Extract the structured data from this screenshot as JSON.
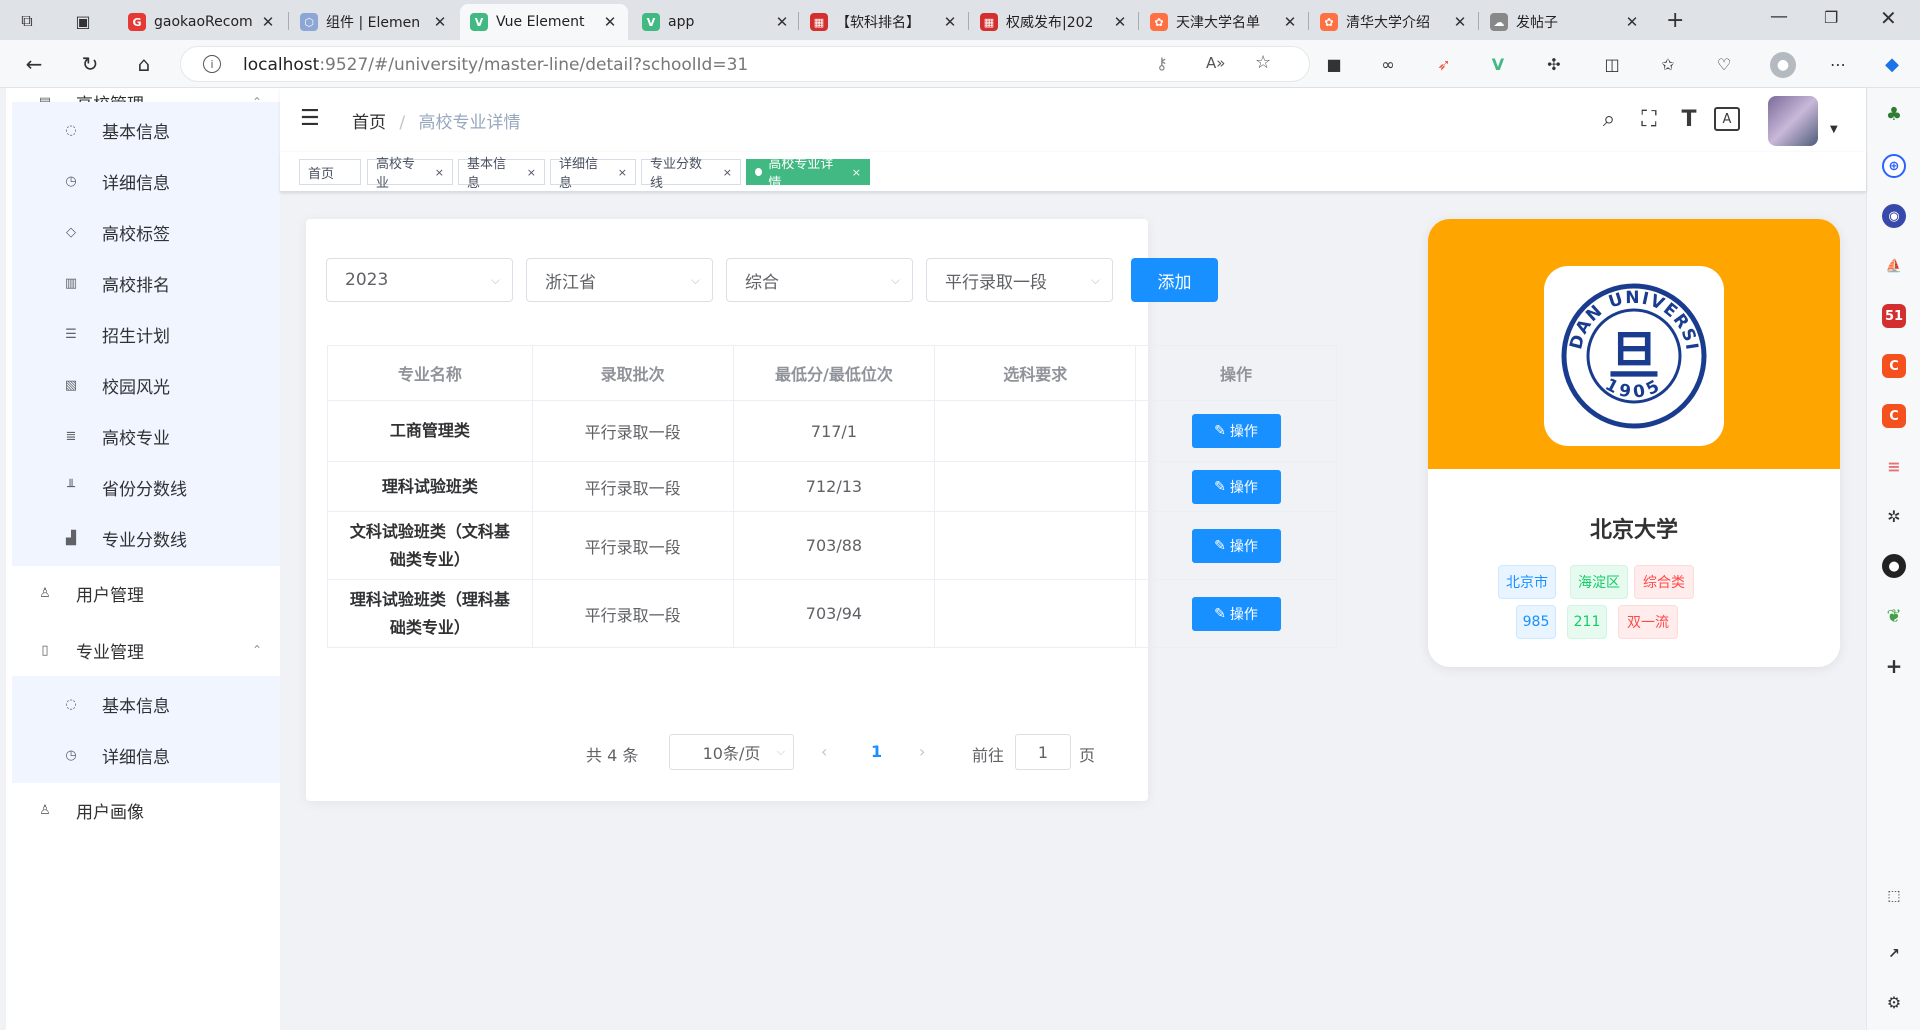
{
  "browser": {
    "tabs": [
      {
        "title": "gaokaoRecom",
        "fav_color": "#e53935",
        "fav_char": "G"
      },
      {
        "title": "组件 | Elemen",
        "fav_color": "#8ca6d6",
        "fav_char": "⬡"
      },
      {
        "title": "Vue Element",
        "fav_color": "#42b983",
        "fav_char": "V",
        "active": true
      },
      {
        "title": "app",
        "fav_color": "#42b983",
        "fav_char": "V"
      },
      {
        "title": "【软科排名】",
        "fav_color": "#d32f2f",
        "fav_char": "▦"
      },
      {
        "title": "权威发布|202",
        "fav_color": "#d32f2f",
        "fav_char": "▦"
      },
      {
        "title": "天津大学名单",
        "fav_color": "#ff7043",
        "fav_char": "✿"
      },
      {
        "title": "清华大学介绍",
        "fav_color": "#ff7043",
        "fav_char": "✿"
      },
      {
        "title": "发帖子",
        "fav_color": "#888888",
        "fav_char": "☁"
      }
    ],
    "new_tab": "+",
    "url_host": "localhost",
    "url_rest": ":9527/#/university/master-line/detail?schoolId=31"
  },
  "sidebar": {
    "items": [
      {
        "label": "高校管理",
        "type": "top",
        "icon": "university-icon",
        "glyph": "▤",
        "caret": "⌃"
      },
      {
        "label": "基本信息",
        "type": "sub",
        "icon": "chat-icon",
        "glyph": "◌"
      },
      {
        "label": "详细信息",
        "type": "sub",
        "icon": "clock-icon",
        "glyph": "◷"
      },
      {
        "label": "高校标签",
        "type": "sub",
        "icon": "tag-icon",
        "glyph": "◇"
      },
      {
        "label": "高校排名",
        "type": "sub",
        "icon": "bar-chart-icon",
        "glyph": "▥"
      },
      {
        "label": "招生计划",
        "type": "sub",
        "icon": "document-icon",
        "glyph": "☰"
      },
      {
        "label": "校园风光",
        "type": "sub",
        "icon": "picture-icon",
        "glyph": "▧"
      },
      {
        "label": "高校专业",
        "type": "sub",
        "icon": "list-icon",
        "glyph": "≣"
      },
      {
        "label": "省份分数线",
        "type": "sub",
        "icon": "line-chart-icon",
        "glyph": "╨"
      },
      {
        "label": "专业分数线",
        "type": "sub",
        "icon": "chart-icon",
        "glyph": "▟"
      },
      {
        "label": "用户管理",
        "type": "top",
        "icon": "users-icon",
        "glyph": "♙"
      },
      {
        "label": "专业管理",
        "type": "top",
        "icon": "book-icon",
        "glyph": "▯",
        "caret": "⌃"
      },
      {
        "label": "基本信息",
        "type": "sub",
        "icon": "chat-icon",
        "glyph": "◌"
      },
      {
        "label": "详细信息",
        "type": "sub",
        "icon": "clock-icon",
        "glyph": "◷"
      },
      {
        "label": "用户画像",
        "type": "top",
        "icon": "users-icon",
        "glyph": "♙"
      }
    ]
  },
  "navbar": {
    "breadcrumb": [
      "首页",
      "高校专业详情"
    ],
    "separator": "/"
  },
  "tags_view": [
    {
      "label": "首页",
      "closable": false
    },
    {
      "label": "高校专业",
      "closable": true
    },
    {
      "label": "基本信息",
      "closable": true
    },
    {
      "label": "详细信息",
      "closable": true
    },
    {
      "label": "专业分数线",
      "closable": true
    },
    {
      "label": "高校专业详情",
      "closable": true,
      "active": true
    }
  ],
  "filters": {
    "year": "2023",
    "province": "浙江省",
    "category": "综合",
    "batch": "平行录取一段",
    "add_label": "添加"
  },
  "table": {
    "headers": [
      "专业名称",
      "录取批次",
      "最低分/最低位次",
      "选科要求",
      "操作"
    ],
    "rows": [
      {
        "name": "工商管理类",
        "batch": "平行录取一段",
        "score": "717/1",
        "req": "",
        "action": "操作"
      },
      {
        "name": "理科试验班类",
        "batch": "平行录取一段",
        "score": "712/13",
        "req": "",
        "action": "操作"
      },
      {
        "name": "文科试验班类（文科基础类专业）",
        "batch": "平行录取一段",
        "score": "703/88",
        "req": "",
        "action": "操作"
      },
      {
        "name": "理科试验班类（理科基础类专业）",
        "batch": "平行录取一段",
        "score": "703/94",
        "req": "",
        "action": "操作"
      }
    ]
  },
  "pagination": {
    "total": "共 4 条",
    "page_size": "10条/页",
    "current": "1",
    "goto_prefix": "前往",
    "goto_value": "1",
    "goto_suffix": "页"
  },
  "school": {
    "name": "北京大学",
    "logo_text_top": "FUDAN UNIVERSITY",
    "logo_year": "1905",
    "logo_char": "旦",
    "tags_row1": [
      {
        "label": "北京市",
        "style": "b"
      },
      {
        "label": "海淀区",
        "style": "g"
      },
      {
        "label": "综合类",
        "style": "r"
      }
    ],
    "tags_row2": [
      {
        "label": "985",
        "style": "b"
      },
      {
        "label": "211",
        "style": "g"
      },
      {
        "label": "双一流",
        "style": "r"
      }
    ],
    "banner_color": "#ffa500"
  },
  "colors": {
    "primary": "#1890ff",
    "tag_active": "#42b983"
  }
}
